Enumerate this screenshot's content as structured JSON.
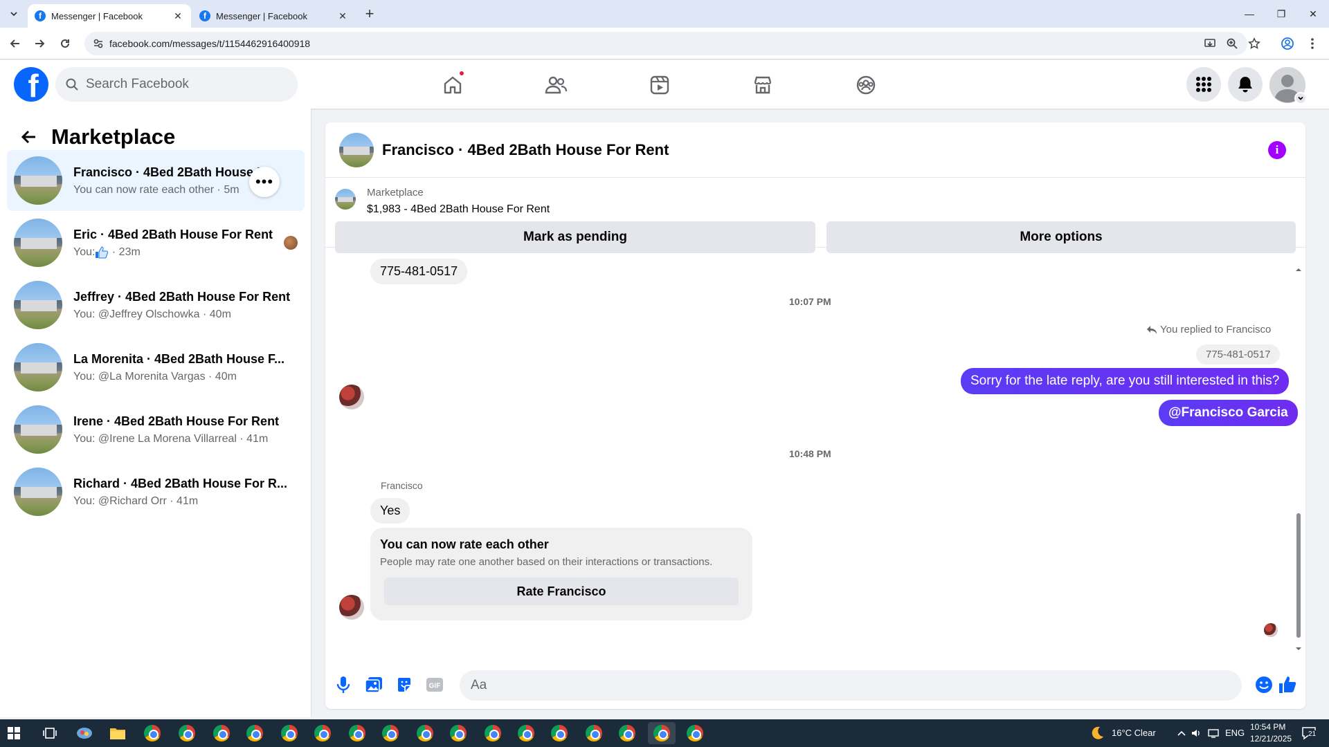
{
  "browser": {
    "tabs": [
      {
        "title": "Messenger | Facebook",
        "active": true
      },
      {
        "title": "Messenger | Facebook",
        "active": false
      }
    ],
    "url": "facebook.com/messages/t/1154462916400918"
  },
  "fbnav": {
    "logo": "f",
    "search_placeholder": "Search Facebook",
    "icons": [
      "home-icon",
      "friends-icon",
      "video-icon",
      "marketplace-icon",
      "groups-icon"
    ],
    "right_icons": [
      "menu-grid-icon",
      "notifications-icon",
      "profile-icon"
    ]
  },
  "sidebar": {
    "title": "Marketplace",
    "conversations": [
      {
        "title": "Francisco · 4Bed 2Bath House For Rent",
        "sub": "You can now rate each other",
        "time": "5m"
      },
      {
        "title": "Eric · 4Bed 2Bath House For Rent",
        "sub": "You: ",
        "time": "23m"
      },
      {
        "title": "Jeffrey · 4Bed 2Bath House For Rent",
        "sub": "You: @Jeffrey Olschowka",
        "time": "40m"
      },
      {
        "title": "La Morenita · 4Bed 2Bath House F...",
        "sub": "You: @La Morenita Vargas",
        "time": "40m"
      },
      {
        "title": "Irene · 4Bed 2Bath House For Rent",
        "sub": "You: @Irene La Morena Villarreal",
        "time": "41m"
      },
      {
        "title": "Richard · 4Bed 2Bath House For R...",
        "sub": "You: @Richard Orr",
        "time": "41m"
      }
    ]
  },
  "chat": {
    "title": "Francisco · 4Bed 2Bath House For Rent",
    "listing_label": "Marketplace",
    "listing_price": "$1,983 - 4Bed 2Bath House For Rent",
    "mark_pending": "Mark as pending",
    "more_options": "More options",
    "messages": {
      "phone_in": "775-481-0517",
      "time1": "10:07 PM",
      "reply_note": "You replied to Francisco",
      "reply_quote": "775-481-0517",
      "out1": "Sorry for the late reply, are you still interested in this?",
      "out2": "@Francisco Garcia",
      "time2": "10:48 PM",
      "sender": "Francisco",
      "in_yes": "Yes",
      "rate_title": "You can now rate each other",
      "rate_sub": "People may rate one another based on their interactions or transactions.",
      "rate_btn": "Rate Francisco"
    },
    "composer_placeholder": "Aa"
  },
  "taskbar": {
    "weather": "16°C Clear",
    "lang": "ENG",
    "time": "10:54 PM",
    "date": "12/21/2025",
    "notif_count": "21"
  }
}
